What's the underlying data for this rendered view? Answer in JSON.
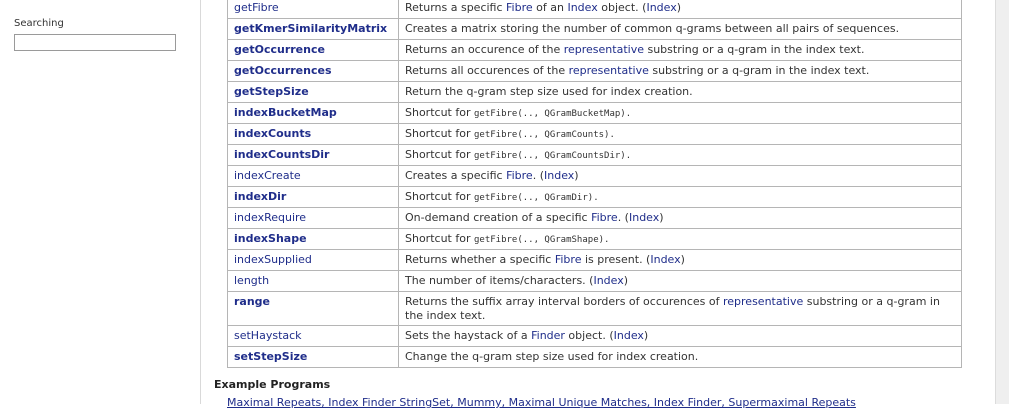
{
  "sidebar": {
    "search_label": "Searching",
    "search_value": ""
  },
  "rows": [
    {
      "name": "getFibre",
      "bold": false,
      "parts": [
        [
          "Returns a specific ",
          "t"
        ],
        [
          "Fibre",
          "l"
        ],
        [
          " of an ",
          "t"
        ],
        [
          "Index",
          "l"
        ],
        [
          " object. (",
          "t"
        ],
        [
          "Index",
          "l"
        ],
        [
          ")",
          "t"
        ]
      ]
    },
    {
      "name": "getKmerSimilarityMatrix",
      "bold": true,
      "parts": [
        [
          "Creates a matrix storing the number of common q-grams between all pairs of sequences.",
          "t"
        ]
      ]
    },
    {
      "name": "getOccurrence",
      "bold": true,
      "parts": [
        [
          "Returns an occurence of the ",
          "t"
        ],
        [
          "representative",
          "l"
        ],
        [
          " substring or a q-gram in the index text.",
          "t"
        ]
      ]
    },
    {
      "name": "getOccurrences",
      "bold": true,
      "parts": [
        [
          "Returns all occurences of the ",
          "t"
        ],
        [
          "representative",
          "l"
        ],
        [
          " substring or a q-gram in the index text.",
          "t"
        ]
      ]
    },
    {
      "name": "getStepSize",
      "bold": true,
      "parts": [
        [
          "Return the q-gram step size used for index creation.",
          "t"
        ]
      ]
    },
    {
      "name": "indexBucketMap",
      "bold": true,
      "parts": [
        [
          "Shortcut for ",
          "t"
        ],
        [
          "getFibre(.., QGramBucketMap).",
          "c"
        ]
      ]
    },
    {
      "name": "indexCounts",
      "bold": true,
      "parts": [
        [
          "Shortcut for ",
          "t"
        ],
        [
          "getFibre(.., QGramCounts).",
          "c"
        ]
      ]
    },
    {
      "name": "indexCountsDir",
      "bold": true,
      "parts": [
        [
          "Shortcut for ",
          "t"
        ],
        [
          "getFibre(.., QGramCountsDir).",
          "c"
        ]
      ]
    },
    {
      "name": "indexCreate",
      "bold": false,
      "parts": [
        [
          "Creates a specific ",
          "t"
        ],
        [
          "Fibre",
          "l"
        ],
        [
          ". (",
          "t"
        ],
        [
          "Index",
          "l"
        ],
        [
          ")",
          "t"
        ]
      ]
    },
    {
      "name": "indexDir",
      "bold": true,
      "parts": [
        [
          "Shortcut for ",
          "t"
        ],
        [
          "getFibre(.., QGramDir).",
          "c"
        ]
      ]
    },
    {
      "name": "indexRequire",
      "bold": false,
      "parts": [
        [
          "On-demand creation of a specific ",
          "t"
        ],
        [
          "Fibre",
          "l"
        ],
        [
          ". (",
          "t"
        ],
        [
          "Index",
          "l"
        ],
        [
          ")",
          "t"
        ]
      ]
    },
    {
      "name": "indexShape",
      "bold": true,
      "parts": [
        [
          "Shortcut for ",
          "t"
        ],
        [
          "getFibre(.., QGramShape).",
          "c"
        ]
      ]
    },
    {
      "name": "indexSupplied",
      "bold": false,
      "parts": [
        [
          "Returns whether a specific ",
          "t"
        ],
        [
          "Fibre",
          "l"
        ],
        [
          " is present. (",
          "t"
        ],
        [
          "Index",
          "l"
        ],
        [
          ")",
          "t"
        ]
      ]
    },
    {
      "name": "length",
      "bold": false,
      "parts": [
        [
          "The number of items/characters. (",
          "t"
        ],
        [
          "Index",
          "l"
        ],
        [
          ")",
          "t"
        ]
      ]
    },
    {
      "name": "range",
      "bold": true,
      "parts": [
        [
          "Returns the suffix array interval borders of occurences of ",
          "t"
        ],
        [
          "representative",
          "l"
        ],
        [
          " substring or a q-gram in the index text.",
          "t"
        ]
      ]
    },
    {
      "name": "setHaystack",
      "bold": false,
      "parts": [
        [
          "Sets the haystack of a ",
          "t"
        ],
        [
          "Finder",
          "l"
        ],
        [
          " object. (",
          "t"
        ],
        [
          "Index",
          "l"
        ],
        [
          ")",
          "t"
        ]
      ]
    },
    {
      "name": "setStepSize",
      "bold": true,
      "parts": [
        [
          "Change the q-gram step size used for index creation.",
          "t"
        ]
      ]
    }
  ],
  "examples": {
    "title": "Example Programs",
    "links_text": "Maximal Repeats, Index Finder StringSet, Mummy, Maximal Unique Matches, Index Finder, Supermaximal Repeats"
  }
}
